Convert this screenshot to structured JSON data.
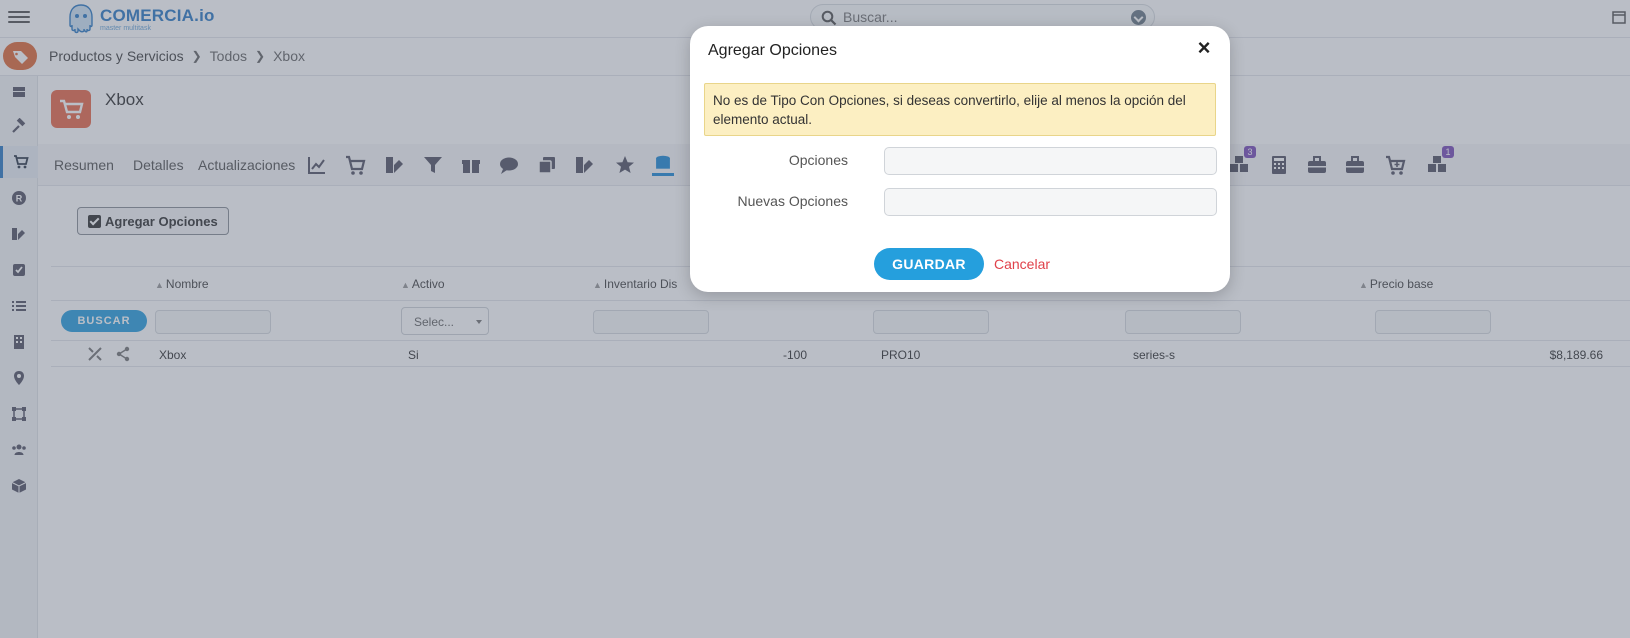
{
  "app": {
    "brand": "COMERCIA.io",
    "tagline": "master multitask"
  },
  "search": {
    "placeholder": "Buscar..."
  },
  "breadcrumb": {
    "items": [
      "Productos y Servicios",
      "Todos",
      "Xbox"
    ]
  },
  "product": {
    "name": "Xbox"
  },
  "tabs": {
    "text_tabs": [
      "Resumen",
      "Detalles",
      "Actualizaciones"
    ],
    "badges": [
      "3",
      "1"
    ]
  },
  "toolbar": {
    "add_options_label": "Agregar Opciones"
  },
  "table": {
    "headers": {
      "nombre": "Nombre",
      "activo": "Activo",
      "inventario": "Inventario Dis",
      "precio": "Precio base"
    },
    "search_button": "BUSCAR",
    "select_placeholder": "Selec...",
    "row": {
      "nombre": "Xbox",
      "activo": "Si",
      "inventario": "-100",
      "codigo": "PRO10",
      "modelo": "series-s",
      "precio": "$8,189.66"
    }
  },
  "modal": {
    "title": "Agregar Opciones",
    "close": "×",
    "alert": "No es de Tipo Con Opciones, si deseas convertirlo, elije al menos la opción del elemento actual.",
    "field_opciones": "Opciones",
    "field_nuevas": "Nuevas Opciones",
    "save": "GUARDAR",
    "cancel": "Cancelar"
  },
  "colors": {
    "primary": "#259fdd",
    "brand": "#2e7bc4",
    "alert_bg": "#fcefc2",
    "cancel": "#e0414a",
    "badge": "#7a4fb8"
  }
}
